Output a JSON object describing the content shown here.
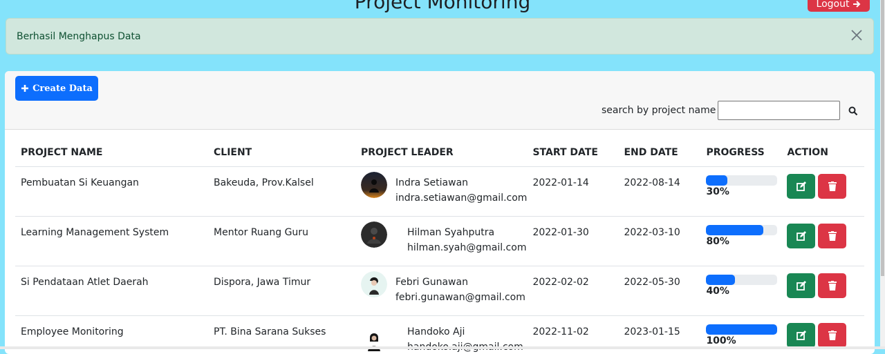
{
  "header": {
    "title": "Project Monitoring",
    "logout_label": "Logout"
  },
  "alert": {
    "message": "Berhasil Menghapus Data"
  },
  "toolbar": {
    "create_label": "Create Data",
    "search_label": "search by project name :",
    "search_value": ""
  },
  "table": {
    "columns": [
      "PROJECT NAME",
      "CLIENT",
      "PROJECT LEADER",
      "START DATE",
      "END DATE",
      "PROGRESS",
      "ACTION"
    ],
    "rows": [
      {
        "project": "Pembuatan Si Keuangan",
        "client": "Bakeuda, Prov.Kalsel",
        "leader_name": "Indra Setiawan",
        "leader_email": "indra.setiawan@gmail.com",
        "start": "2022-01-14",
        "end": "2022-08-14",
        "progress": "30%"
      },
      {
        "project": "Learning Management System",
        "client": "Mentor Ruang Guru",
        "leader_name": "Hilman Syahputra",
        "leader_email": "hilman.syah@gmail.com",
        "start": "2022-01-30",
        "end": "2022-03-10",
        "progress": "80%"
      },
      {
        "project": "Si Pendataan Atlet Daerah",
        "client": "Dispora, Jawa Timur",
        "leader_name": "Febri Gunawan",
        "leader_email": "febri.gunawan@gmail.com",
        "start": "2022-02-02",
        "end": "2022-05-30",
        "progress": "40%"
      },
      {
        "project": "Employee Monitoring",
        "client": "PT. Bina Sarana Sukses",
        "leader_name": "Handoko Aji",
        "leader_email": "handoko.aji@gmail.com",
        "start": "2022-11-02",
        "end": "2023-01-15",
        "progress": "100%"
      }
    ]
  },
  "colors": {
    "page_bg": "#84e3fb",
    "primary": "#0d6efd",
    "success": "#198754",
    "danger": "#dc3545",
    "alert_bg": "#d1e7dd",
    "alert_text": "#0f5132"
  },
  "icons": [
    "arrow-right-icon",
    "close-icon",
    "plus-icon",
    "search-icon",
    "edit-icon",
    "trash-icon"
  ]
}
